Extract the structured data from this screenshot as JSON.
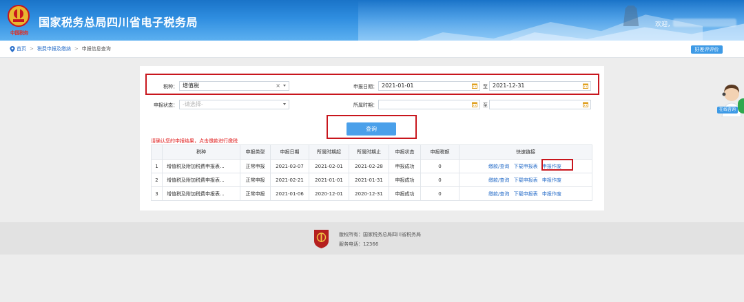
{
  "header": {
    "emblem_text": "中国税务",
    "site_title": "国家税务总局四川省电子税务局",
    "welcome": "欢迎，"
  },
  "breadcrumb": {
    "items": [
      "首页",
      "税费申报及缴纳",
      "申报信息查询"
    ]
  },
  "rate_button": "好差评评价",
  "form": {
    "tax_type": {
      "label": "税种：",
      "value": "增值税"
    },
    "declare_date": {
      "label": "申报日期：",
      "from": "2021-01-01",
      "to_label": "至",
      "to": "2021-12-31"
    },
    "status": {
      "label": "申报状态：",
      "placeholder": "-请选择-"
    },
    "period": {
      "label": "所属时期：",
      "from": "",
      "to_label": "至",
      "to": ""
    },
    "query_button": "查询"
  },
  "hint": "请确认您的申报结果，点击缴款进行缴税",
  "table": {
    "headers": [
      "",
      "税种",
      "申报类型",
      "申报日期",
      "所属时期起",
      "所属时期止",
      "申报状态",
      "申报税额",
      "快速链接"
    ],
    "rows": [
      {
        "no": "1",
        "tax": "增值税及附加税费申报表...",
        "type": "正常申报",
        "date": "2021-03-07",
        "start": "2021-02-01",
        "end": "2021-02-28",
        "status": "申报成功",
        "amount": "0"
      },
      {
        "no": "2",
        "tax": "增值税及附加税费申报表...",
        "type": "正常申报",
        "date": "2021-02-21",
        "start": "2021-01-01",
        "end": "2021-01-31",
        "status": "申报成功",
        "amount": "0"
      },
      {
        "no": "3",
        "tax": "增值税及附加税费申报表...",
        "type": "正常申报",
        "date": "2021-01-06",
        "start": "2020-12-01",
        "end": "2020-12-31",
        "status": "申报成功",
        "amount": "0"
      }
    ],
    "links": {
      "pay": "缴款/查询",
      "download": "下载申报表",
      "void": "申报作废"
    }
  },
  "footer": {
    "copyright": "版权所有：国家税务总局四川省税务局",
    "phone": "服务电话：12366"
  },
  "online_service": "在线咨询",
  "colors": {
    "header_blue": "#1a73c8",
    "link_blue": "#2a6fc9",
    "highlight_red": "#c8161d",
    "button_blue": "#4aa0ea"
  }
}
